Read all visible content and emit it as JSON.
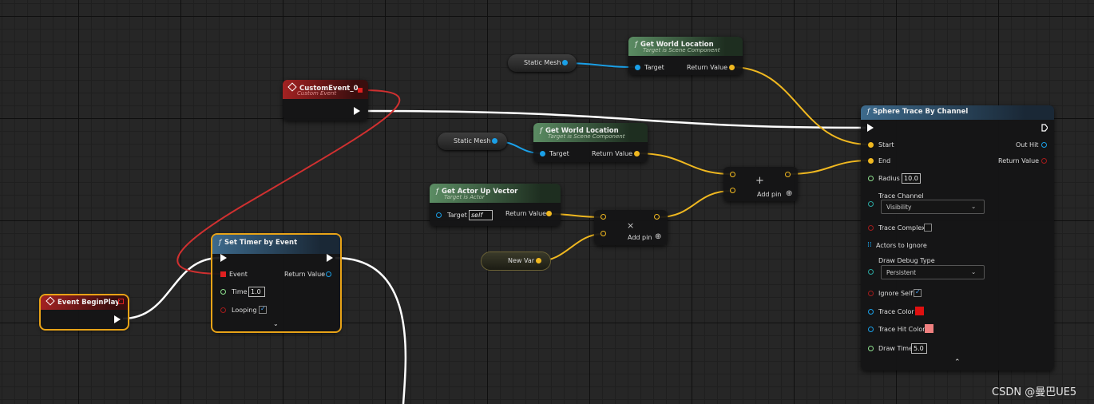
{
  "get_world_location_1": {
    "title": "Get World Location",
    "subtitle": "Target is Scene Component",
    "target": "Target",
    "return": "Return Value"
  },
  "get_world_location_2": {
    "title": "Get World Location",
    "subtitle": "Target is Scene Component",
    "target": "Target",
    "return": "Return Value"
  },
  "static_mesh_1": {
    "label": "Static Mesh"
  },
  "static_mesh_2": {
    "label": "Static Mesh"
  },
  "custom_event": {
    "title": "CustomEvent_0",
    "subtitle": "Custom Event"
  },
  "actor_up": {
    "title": "Get Actor Up Vector",
    "subtitle": "Target is Actor",
    "target": "Target",
    "target_value": "self",
    "return": "Return Value"
  },
  "new_var": {
    "label": "New Var"
  },
  "add_node": {
    "symbol": "+",
    "add_pin": "Add pin"
  },
  "mul_node": {
    "symbol": "×",
    "add_pin": "Add pin"
  },
  "set_timer": {
    "title": "Set Timer by Event",
    "event": "Event",
    "return": "Return Value",
    "time": "Time",
    "time_value": "1.0",
    "looping": "Looping"
  },
  "begin_play": {
    "title": "Event BeginPlay"
  },
  "sphere_trace": {
    "title": "Sphere Trace By Channel",
    "start": "Start",
    "end": "End",
    "out_hit": "Out Hit",
    "return": "Return Value",
    "radius": "Radius",
    "radius_value": "10.0",
    "trace_channel": "Trace Channel",
    "trace_channel_value": "Visibility",
    "trace_complex": "Trace Complex",
    "actors_to_ignore": "Actors to Ignore",
    "draw_debug_type": "Draw Debug Type",
    "draw_debug_value": "Persistent",
    "ignore_self": "Ignore Self",
    "trace_color": "Trace Color",
    "trace_hit_color": "Trace Hit Color",
    "draw_time": "Draw Time",
    "draw_time_value": "5.0"
  },
  "colors": {
    "trace_color": "#e01010",
    "trace_hit_color": "#f08080",
    "vector_wire": "#f0b820",
    "object_wire": "#1aa0e8",
    "exec_wire": "#ffffff",
    "delegate_wire": "#d03030"
  },
  "watermark": "CSDN @曼巴UE5"
}
